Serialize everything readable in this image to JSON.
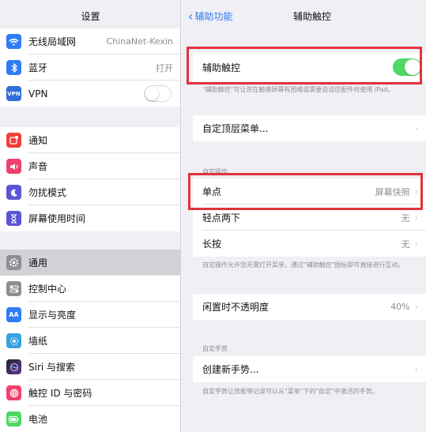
{
  "settings": {
    "title": "设置",
    "group1": [
      {
        "icon": "wifi-icon",
        "color": "#2f7cf6",
        "label": "无线局域网",
        "value": "ChinaNet-Kexin"
      },
      {
        "icon": "bluetooth-icon",
        "color": "#2f7cf6",
        "label": "蓝牙",
        "value": "打开"
      },
      {
        "icon": "vpn-icon",
        "color": "#2f6fd9",
        "label": "VPN",
        "value": ""
      }
    ],
    "group2": [
      {
        "icon": "notifications-icon",
        "color": "#f0403b",
        "label": "通知"
      },
      {
        "icon": "sounds-icon",
        "color": "#f0406c",
        "label": "声音"
      },
      {
        "icon": "moon-icon",
        "color": "#5a55d6",
        "label": "勿扰模式"
      },
      {
        "icon": "hourglass-icon",
        "color": "#5a55d6",
        "label": "屏幕使用时间"
      }
    ],
    "group3": [
      {
        "icon": "gear-icon",
        "color": "#8e8e93",
        "label": "通用"
      },
      {
        "icon": "control-center-icon",
        "color": "#8e8e93",
        "label": "控制中心"
      },
      {
        "icon": "display-icon",
        "color": "#2f7cf6",
        "label": "显示与亮度"
      },
      {
        "icon": "wallpaper-icon",
        "color": "#3aa0e0",
        "label": "墙纸"
      },
      {
        "icon": "siri-icon",
        "color": "#333344",
        "label": "Siri 与搜索"
      },
      {
        "icon": "touch-id-icon",
        "color": "#f0406c",
        "label": "触控 ID 与密码"
      },
      {
        "icon": "battery-icon",
        "color": "#4cd964",
        "label": "电池"
      }
    ]
  },
  "assistive": {
    "back_label": "辅助功能",
    "title": "辅助触控",
    "toggle_label": "辅助触控",
    "toggle_note": "\"辅助触控\"可让您在触摸屏幕有困难或需要自适应配件时使用 iPad。",
    "menu_label": "自定顶层菜单...",
    "actions_header": "自定操作",
    "single_tap_label": "单点",
    "single_tap_value": "屏幕快照",
    "double_tap_label": "轻点两下",
    "double_tap_value": "无",
    "long_press_label": "长按",
    "long_press_value": "无",
    "actions_note": "自定操作允许您无需打开菜单，通过\"辅助触控\"图标即可直接进行互动。",
    "opacity_label": "闲置时不透明度",
    "opacity_value": "40%",
    "gestures_header": "自定手势",
    "new_gesture_label": "创建新手势...",
    "gestures_note": "自定手势让您能够记录可以从\"菜单\"下的\"自定\"中激活的手势。"
  },
  "colors": {
    "accent": "#2f7cf6",
    "toggle_on": "#4cd964",
    "highlight": "#e2323c"
  }
}
